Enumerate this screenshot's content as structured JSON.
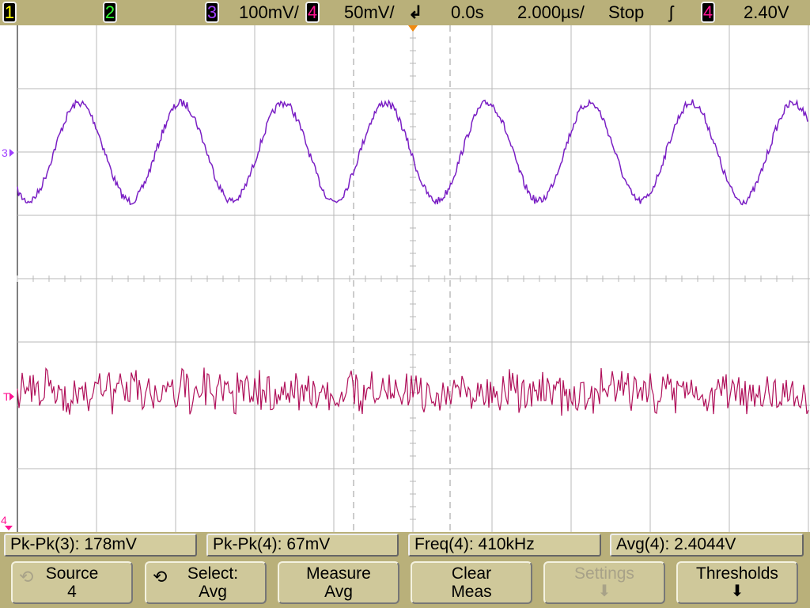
{
  "header": {
    "channels": [
      {
        "num": "1",
        "color": "#ffff00"
      },
      {
        "num": "2",
        "color": "#00ff00"
      },
      {
        "num": "3",
        "color": "#9b30ff",
        "scale": "100mV/"
      },
      {
        "num": "4",
        "color": "#ff1493",
        "scale": "50mV/"
      }
    ],
    "time_offset": "0.0s",
    "timebase": "2.000µs/",
    "run_state": "Stop",
    "trigger_source": "4",
    "trigger_level": "2.40V"
  },
  "markers": {
    "ch3": "3",
    "trigger": "T",
    "ch4": "4"
  },
  "measurements": [
    {
      "label": "Pk-Pk(3): 178mV"
    },
    {
      "label": "Pk-Pk(4): 67mV"
    },
    {
      "label": "Freq(4): 410kHz"
    },
    {
      "label": "Avg(4): 2.4044V"
    }
  ],
  "softkeys": [
    {
      "line1": "Source",
      "line2": "4",
      "enabled": true
    },
    {
      "line1": "Select:",
      "line2": "Avg",
      "enabled": true
    },
    {
      "line1": "Measure",
      "line2": "Avg",
      "enabled": true
    },
    {
      "line1": "Clear",
      "line2": "Meas",
      "enabled": true
    },
    {
      "line1": "Settings",
      "line2": "",
      "enabled": false
    },
    {
      "line1": "Thresholds",
      "line2": "",
      "enabled": true
    }
  ],
  "colors": {
    "ch3": "#7a1fc4",
    "ch4": "#b0105a",
    "grid": "#b8b8b8",
    "trigger_marker": "#f08a10"
  }
}
